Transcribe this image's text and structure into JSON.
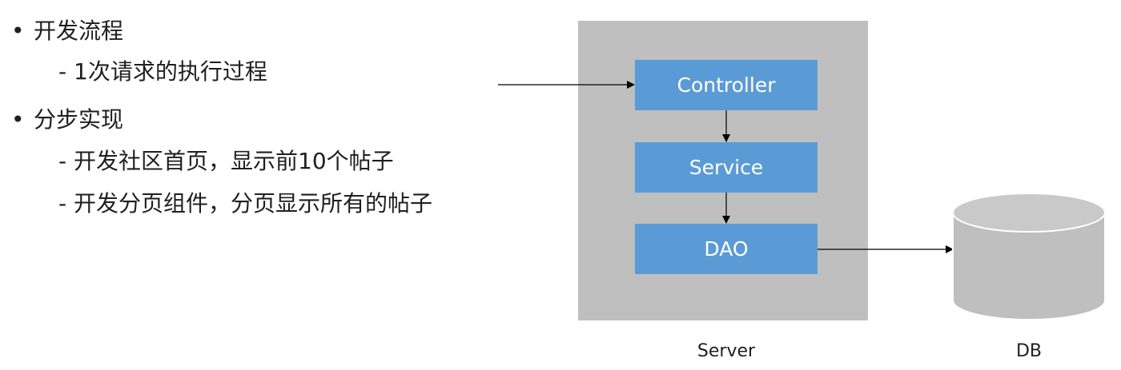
{
  "bullets": [
    {
      "text": "开发流程",
      "subs": [
        "- 1次请求的执行过程"
      ]
    },
    {
      "text": "分步实现",
      "subs": [
        "- 开发社区首页，显示前10个帖子",
        "- 开发分页组件，分页显示所有的帖子"
      ]
    }
  ],
  "bullet_symbol": "•",
  "diagram": {
    "layers": [
      "Controller",
      "Service",
      "DAO"
    ],
    "server_label": "Server",
    "db_label": "DB",
    "colors": {
      "server_bg": "#bfbfbf",
      "layer_bg": "#5b9bd5",
      "layer_text": "#ffffff",
      "db_fill": "#bfbfbf",
      "arrow": "#000000"
    }
  }
}
